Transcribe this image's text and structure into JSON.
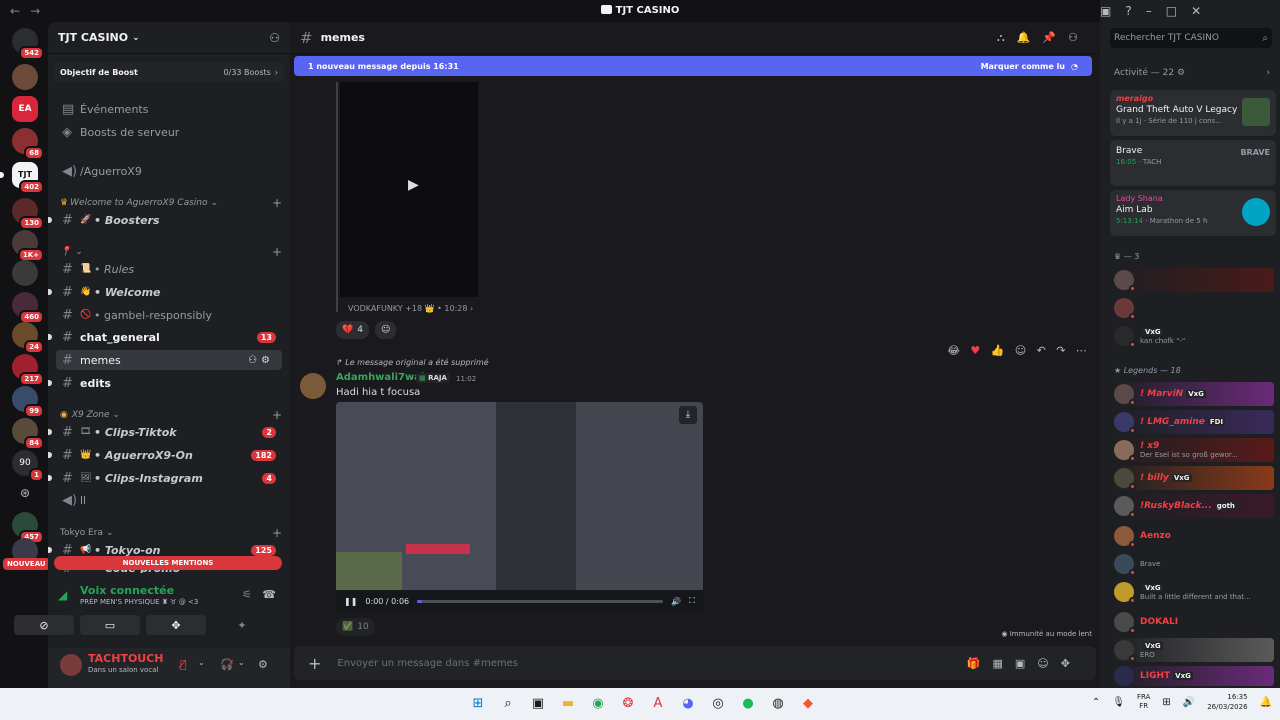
{
  "window": {
    "title": "TJT CASINO"
  },
  "guilds": {
    "badges": [
      "542",
      "68",
      "402",
      "130",
      "1K+",
      "460",
      "24",
      "217",
      "99",
      "84",
      "1",
      "457"
    ],
    "new_label": "NOUVEAU",
    "ea_label": "EA"
  },
  "sidebar": {
    "server_name": "TJT CASINO",
    "boost_label": "Objectif de Boost",
    "boost_count": "0/33 Boosts",
    "events": "Événements",
    "server_boosts": "Boosts de serveur",
    "voice_channel": "/AguerroX9",
    "cat_welcome": "Welcome to AguerroX9 Casino",
    "ch_boosters": "• Boosters",
    "cat_pin": "",
    "ch_rules": "• Rules",
    "ch_welcome": "• Welcome",
    "ch_gamble": "• gambel-responsibly",
    "ch_general": "chat_general",
    "ch_general_badge": "13",
    "ch_memes": "memes",
    "ch_edits": "edits",
    "cat_x9": "X9 Zone",
    "ch_clips_tiktok": "• Clips-Tiktok",
    "ch_clips_tiktok_badge": "2",
    "ch_aguerro_on": "• AguerroX9-On",
    "ch_aguerro_on_badge": "182",
    "ch_clips_insta": "• Clips-Instagram",
    "ch_clips_insta_badge": "4",
    "ch_ll": "ll",
    "cat_tokyo": "Tokyo Era",
    "ch_tokyo_on": "• Tokyo-on",
    "ch_tokyo_on_badge": "125",
    "ch_code_promo": "• Code-promo",
    "new_mentions": "NOUVELLES MENTIONS"
  },
  "voice": {
    "title": "Voix connectée",
    "channel": "PRÉP MEN'S PHYSIQUE ♜ ♉ @ <3"
  },
  "user": {
    "name": "TACHTOUCH",
    "status": "Dans un salon vocal"
  },
  "channel": {
    "name": "memes",
    "new_messages": "1 nouveau message depuis 16:31",
    "mark_read": "Marquer comme lu",
    "msg1_info": "VODKAFUNKY +18 👑 • 10:28 ›",
    "msg1_react_count": "4",
    "reply_ref": "Le message original a été supprimé",
    "msg2_author": "Adamhwali7wak",
    "msg2_tag": "RAJA",
    "msg2_time": "11:02",
    "msg2_text": "Hadi hia t focusa",
    "video_time": "0:00 / 0:06",
    "video_progress": 0.0,
    "react2_count": "10",
    "slowmode": "Immunité au mode lent",
    "composer_placeholder": "Envoyer un message dans #memes"
  },
  "members": {
    "search_placeholder": "Rechercher TJT CASINO",
    "activity_header": "Activité — 22",
    "cards": [
      {
        "name": "meraigo",
        "game": "Grand Theft Auto V Legacy",
        "meta": "Il y a 1j · Série de 110 j cons..."
      },
      {
        "name": "",
        "game": "Brave",
        "meta_time": "16:05",
        "meta": "TACH"
      },
      {
        "name": "Lady Shana",
        "game": "Aim Lab",
        "meta_time": "5:13:14",
        "meta": "Marathon de 5 h"
      }
    ],
    "group1": "— 3",
    "group1_member_stat": "kan chofk \"-\"",
    "group1_tag": "VxG",
    "group2": "Legends — 18",
    "list": [
      {
        "name": "! MarviN",
        "tag": "VxG",
        "stat": ""
      },
      {
        "name": "! LMG_amine",
        "tag": "FDI",
        "stat": ""
      },
      {
        "name": "! x9",
        "tag": "",
        "stat": "Der Esel ist so groß gewor..."
      },
      {
        "name": "! billy",
        "tag": "VxG",
        "stat": ""
      },
      {
        "name": "!RuskyBlack...",
        "tag": "goth",
        "stat": ""
      },
      {
        "name": "Aenzo",
        "tag": "",
        "stat": ""
      },
      {
        "name": "",
        "tag": "",
        "stat": "Brave"
      },
      {
        "name": "",
        "tag": "VxG",
        "stat": "Built a little different and that..."
      },
      {
        "name": "DOKALI",
        "tag": "",
        "stat": ""
      },
      {
        "name": "",
        "tag": "VxG",
        "stat": "ERO"
      },
      {
        "name": "LIGHT",
        "tag": "VxG",
        "stat": ""
      }
    ]
  },
  "taskbar": {
    "lang1": "FRA",
    "lang2": "FR",
    "time": "16:35",
    "date": "26/03/2026"
  }
}
